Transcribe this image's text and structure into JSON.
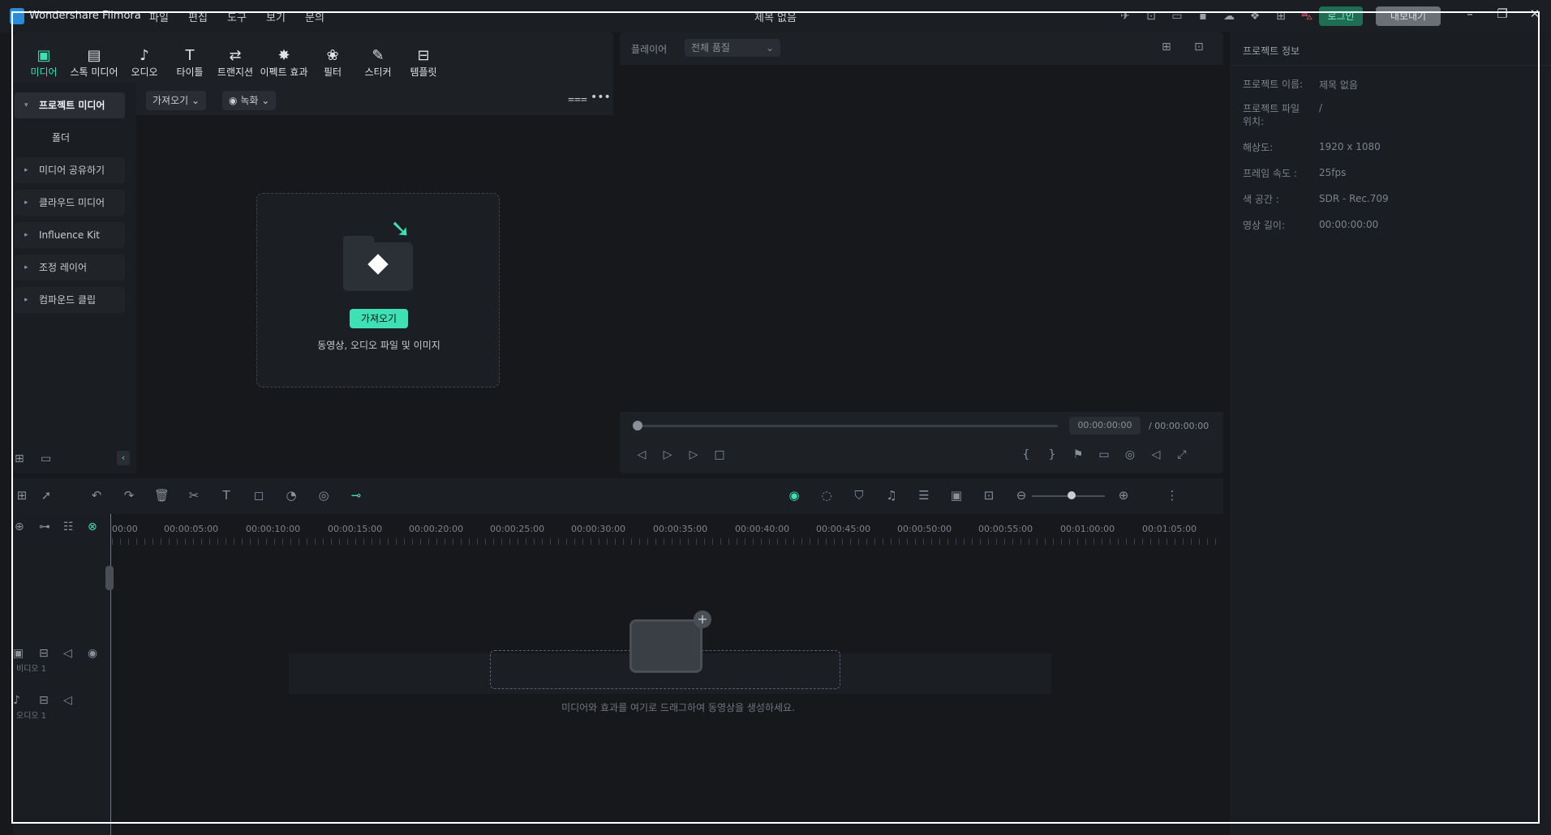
{
  "app": {
    "name": "Wondershare Filmora",
    "doc_title": "제목 없음"
  },
  "menu": [
    "파일",
    "편집",
    "도구",
    "보기",
    "문의"
  ],
  "top_icons": [
    "send-icon",
    "save-icon",
    "layout-icon",
    "disk-icon",
    "cloud-icon",
    "gift-icon",
    "grid-icon",
    "cart-icon"
  ],
  "buttons": {
    "login": "로그인",
    "export": "내보내기"
  },
  "tool_tabs": [
    {
      "label": "미디어",
      "icon": "media-icon",
      "glyph": "▣"
    },
    {
      "label": "스톡 미디어",
      "icon": "stock-media-icon",
      "glyph": "▤"
    },
    {
      "label": "오디오",
      "icon": "music-icon",
      "glyph": "♪"
    },
    {
      "label": "타이틀",
      "icon": "title-icon",
      "glyph": "T"
    },
    {
      "label": "트랜지션",
      "icon": "transition-icon",
      "glyph": "⇄"
    },
    {
      "label": "이펙트 효과",
      "icon": "effects-icon",
      "glyph": "✸"
    },
    {
      "label": "필터",
      "icon": "filter-icon",
      "glyph": "❀"
    },
    {
      "label": "스티커",
      "icon": "sticker-icon",
      "glyph": "✎"
    },
    {
      "label": "템플릿",
      "icon": "template-icon",
      "glyph": "⊟"
    }
  ],
  "sidebar": {
    "project_media": "프로젝트 미디어",
    "folder": "폴더",
    "items": [
      "미디어 공유하기",
      "클라우드 미디어",
      "Influence Kit",
      "조정 레이어",
      "컴파운드 클립"
    ]
  },
  "media_toolbar": {
    "import": "가져오기",
    "record": "녹화"
  },
  "dropzone": {
    "button": "가져오기",
    "description": "동영상, 오디오 파일 및 이미지"
  },
  "player": {
    "label": "플레이어",
    "quality": "전체 품질",
    "current_time": "00:00:00:00",
    "total_time": "/ 00:00:00:00"
  },
  "project_info": {
    "title": "프로젝트 정보",
    "rows": [
      {
        "label": "프로젝트 이름:",
        "value": "제목 없음"
      },
      {
        "label": "프로젝트 파일 위치:",
        "value": "/"
      },
      {
        "label": "해상도:",
        "value": "1920 x 1080"
      },
      {
        "label": "프레임 속도 :",
        "value": "25fps"
      },
      {
        "label": "색 공간 :",
        "value": "SDR - Rec.709"
      },
      {
        "label": "영상 길이:",
        "value": "00:00:00:00"
      }
    ]
  },
  "timeline": {
    "ruler": [
      "00:00",
      "00:00:05:00",
      "00:00:10:00",
      "00:00:15:00",
      "00:00:20:00",
      "00:00:25:00",
      "00:00:30:00",
      "00:00:35:00",
      "00:00:40:00",
      "00:00:45:00",
      "00:00:50:00",
      "00:00:55:00",
      "00:01:00:00",
      "00:01:05:00"
    ],
    "tracks": {
      "video": "비디오 1",
      "audio": "오디오 1"
    },
    "hint": "미디어와 효과를 여기로 드래그하여 동영상을 생성하세요."
  },
  "colors": {
    "accent": "#3fe0b3",
    "background": "#16181b",
    "panel": "#1d2025"
  }
}
